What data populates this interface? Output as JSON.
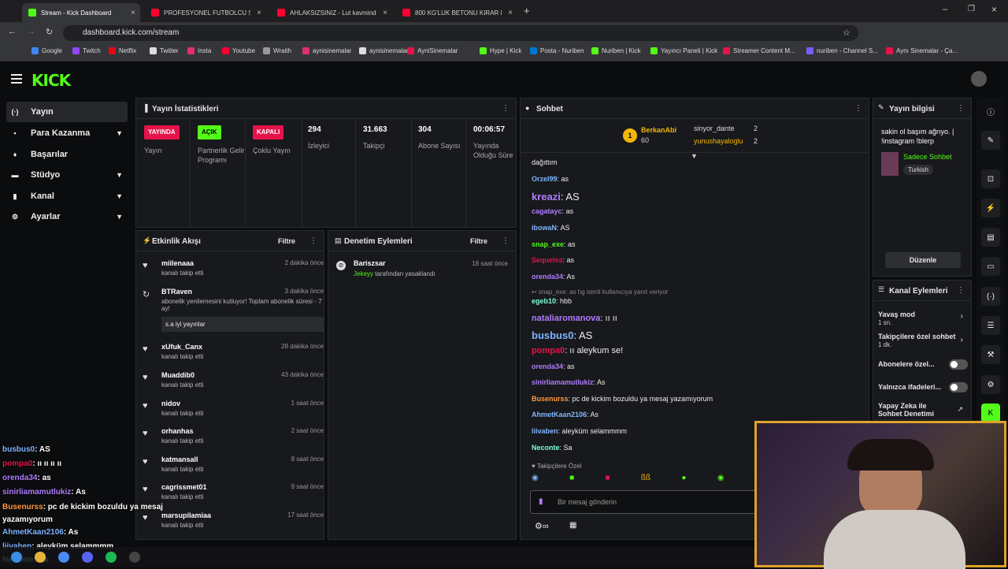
{
  "browser": {
    "tabs": [
      {
        "title": "Stream - Kick Dashboard",
        "color": "#53fc18"
      },
      {
        "title": "PROFESYONEL FUTBOLCU SENO",
        "color": "#ff0033"
      },
      {
        "title": "AHLAKSIZSINIZ - Lut kavminde",
        "color": "#ff0033"
      },
      {
        "title": "800 KG'LUK BETONU KIRAR MI",
        "color": "#ff0033"
      }
    ],
    "url": "dashboard.kick.com/stream",
    "bookmarks": [
      "Google",
      "Twitch",
      "Netflix",
      "Twitter",
      "Insta",
      "Youtube",
      "Wraith",
      "aynisinemalar",
      "aynisinemalar",
      "AyniSinemalar",
      "Hype | Kick",
      "Posta - Nuriben",
      "Nuriben | Kick",
      "Yayıncı Paneli | Kick",
      "Streamer Content M...",
      "nuriben - Channel S...",
      "Aynı Sinemalar - Ça..."
    ]
  },
  "sidebar": {
    "items": [
      {
        "label": "Yayın",
        "icon": "(·)"
      },
      {
        "label": "Para Kazanma",
        "icon": "▪"
      },
      {
        "label": "Başarılar",
        "icon": "♦"
      },
      {
        "label": "Stüdyo",
        "icon": "▬"
      },
      {
        "label": "Kanal",
        "icon": "▮"
      },
      {
        "label": "Ayarlar",
        "icon": "⚙"
      }
    ]
  },
  "stats": {
    "title": "Yayın İstatistikleri",
    "items": [
      {
        "badge": "YAYINDA",
        "badge_color": "#e5134a",
        "label": "Yayın"
      },
      {
        "badge": "AÇIK",
        "badge_color": "#53fc18",
        "label": "Partnerlik Gelir Programı"
      },
      {
        "badge": "KAPALI",
        "badge_color": "#e5134a",
        "label": "Çoklu Yayın"
      },
      {
        "value": "294",
        "label": "İzleyici"
      },
      {
        "value": "31.663",
        "label": "Takipçi"
      },
      {
        "value": "304",
        "label": "Abone Sayısı"
      },
      {
        "value": "00:06:57",
        "label": "Yayında Olduğu Süre"
      }
    ]
  },
  "activity": {
    "title": "Etkinlik Akışı",
    "filter": "Filtre",
    "items": [
      {
        "name": "miilenaaa",
        "sub": "kanalı takip etti",
        "time": "2 dakika önce"
      },
      {
        "name": "BTRaven",
        "sub": "abonelik yenilemesini kutluyor! Toplam abonelik süresi - 7 ay!",
        "time": "3 dakika önce",
        "msg": "s.a iyi yayınlar"
      },
      {
        "name": "xUfuk_Canx",
        "sub": "kanalı takip etti",
        "time": "28 dakika önce"
      },
      {
        "name": "Muaddib0",
        "sub": "kanalı takip etti",
        "time": "43 dakika önce"
      },
      {
        "name": "nidov",
        "sub": "kanalı takip etti",
        "time": "1 saat önce"
      },
      {
        "name": "orhanhas",
        "sub": "kanalı takip etti",
        "time": "2 saat önce"
      },
      {
        "name": "katmansall",
        "sub": "kanalı takip etti",
        "time": "8 saat önce"
      },
      {
        "name": "cagrissmet01",
        "sub": "kanalı takip etti",
        "time": "9 saat önce"
      },
      {
        "name": "marsupilamiaa",
        "sub": "kanalı takip etti",
        "time": "17 saat önce"
      }
    ]
  },
  "moderation": {
    "title": "Denetim Eylemleri",
    "filter": "Filtre",
    "item": {
      "name": "Bariszsar",
      "by": "Jekeyy",
      "action": "tarafından yasaklandı",
      "time": "18 saat önce"
    }
  },
  "chat": {
    "title": "Sohbet",
    "top": {
      "user": "BerkanAbi",
      "count": "60",
      "u2": "sinyor_dante",
      "c2": "2",
      "u3": "yunushayaloglu",
      "c3": "2"
    },
    "lines": [
      {
        "u": "",
        "t": "dağıttım",
        "c": "#bbb"
      },
      {
        "u": "Orzel99",
        "t": ": as",
        "c": "#7fb4ff"
      },
      {
        "u": "kreazi",
        "t": ": AS",
        "c": "#b07cff"
      },
      {
        "u": "cagatayc",
        "t": ": as",
        "c": "#b07cff"
      },
      {
        "u": "ibowaN",
        "t": ": AS",
        "c": "#7fb4ff"
      },
      {
        "u": "snap_exe",
        "t": ": as",
        "c": "#53fc18"
      },
      {
        "u": "Sequelss",
        "t": ": as",
        "c": "#e5134a"
      },
      {
        "u": "orenda34",
        "t": ": As",
        "c": "#b07cff"
      },
      {
        "u": "egeb10",
        "t": ": hbb",
        "c": "#7fffd4"
      },
      {
        "u": "nataliaromanova",
        "t": ": ıı ıı",
        "c": "#b07cff"
      },
      {
        "u": "busbus0",
        "t": ": AS",
        "c": "#7fb4ff"
      },
      {
        "u": "pompa0",
        "t": ": ıı aleykum se!",
        "c": "#e5134a"
      },
      {
        "u": "orenda34",
        "t": ": as",
        "c": "#b07cff"
      },
      {
        "u": "sinirliamamutlukiz",
        "t": ": As",
        "c": "#b07cff"
      },
      {
        "u": "Busenurss",
        "t": ": pc de kickim bozuldu ya mesaj yazamıyorum",
        "c": "#ff9a3c"
      },
      {
        "u": "AhmetKaan2106",
        "t": ": As",
        "c": "#7fb4ff"
      },
      {
        "u": "liivaben",
        "t": ": aleyküm selammmm",
        "c": "#7fb4ff"
      },
      {
        "u": "Neconte",
        "t": ": Sa",
        "c": "#7fffd4"
      }
    ],
    "reply_note": "snap_exe: as hg isimli kullanıcıya yanıt veriyor",
    "followers_only": "Takipçilere Özel",
    "placeholder": "Bir mesaj gönderin"
  },
  "info": {
    "title": "Yayın bilgisi",
    "stream_title": "sakin ol başım ağrıyo. | !instagram !blerp",
    "category": "Sadece Sohbet",
    "tag": "Turkish",
    "edit": "Düzenle"
  },
  "actions": {
    "title": "Kanal Eylemleri",
    "items": [
      {
        "label": "Yavaş mod",
        "sub": "1 sn."
      },
      {
        "label": "Takipçilere özel sohbet",
        "sub": "1 dk."
      },
      {
        "label": "Abonelere özel..."
      },
      {
        "label": "Yalnızca ifadeleri..."
      },
      {
        "label": "Yapay Zeka ile Sohbet Denetimi"
      }
    ]
  },
  "overlay_chat": [
    {
      "u": "busbus0",
      "t": ": AS",
      "c": "#7fb4ff"
    },
    {
      "u": "pompa0",
      "t": ": ıı ıı ıı ıı",
      "c": "#e5134a"
    },
    {
      "u": "orenda34",
      "t": ": as",
      "c": "#b07cff"
    },
    {
      "u": "sinirliamamutlukiz",
      "t": ": As",
      "c": "#b07cff"
    },
    {
      "u": "Busenurss",
      "t": ": pc de kickim bozuldu ya mesaj yazamıyorum",
      "c": "#ff9a3c"
    },
    {
      "u": "AhmetKaan2106",
      "t": ": As",
      "c": "#7fb4ff"
    },
    {
      "u": "liivaben",
      "t": ": aleyküm selammmm",
      "c": "#7fb4ff"
    },
    {
      "u": "Neconte",
      "t": ": Sa",
      "c": "#7fffd4"
    }
  ]
}
